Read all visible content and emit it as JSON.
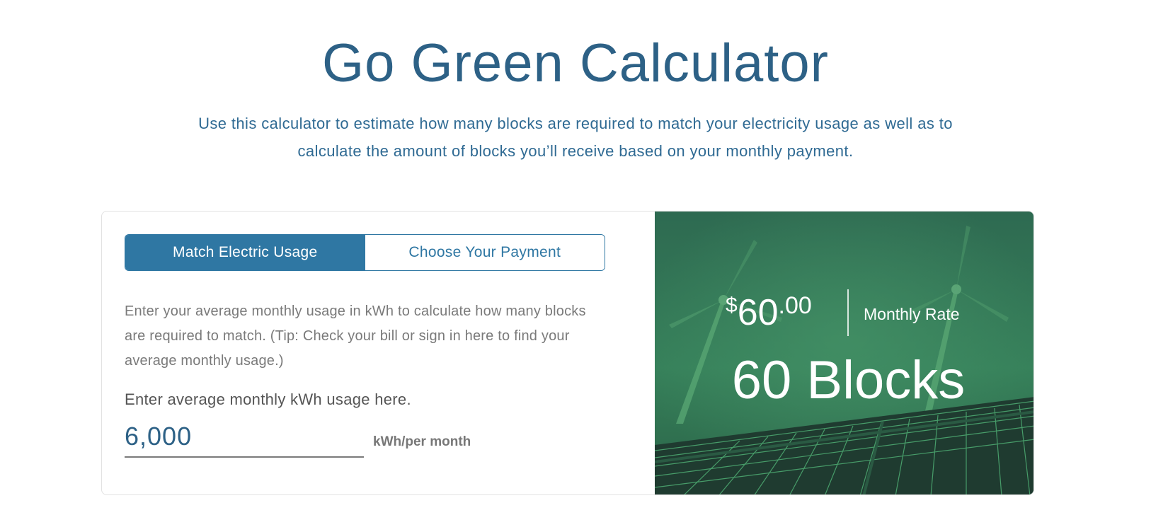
{
  "page": {
    "title": "Go Green Calculator",
    "subtitle": "Use this calculator to estimate how many blocks are required to match your electricity usage as well as to calculate the amount of blocks you’ll receive based on your monthly payment."
  },
  "tabs": [
    {
      "label": "Match Electric Usage",
      "active": true
    },
    {
      "label": "Choose Your Payment",
      "active": false
    }
  ],
  "form": {
    "description": "Enter your average monthly usage in kWh to calculate how many blocks are required to match. (Tip: Check your bill or sign in here to find your average monthly usage.)",
    "field_label": "Enter average monthly kWh usage here.",
    "usage_value": "6,000",
    "unit": "kWh/per month"
  },
  "result": {
    "currency_symbol": "$",
    "dollars": "60",
    "cents": ".00",
    "rate_label": "Monthly Rate",
    "blocks": "60 Blocks"
  },
  "colors": {
    "accent": "#2f77a3",
    "title": "#2d6186",
    "panel_green": "#2f6b4f"
  },
  "icons": {
    "background": "wind-turbines-solar-panels-illustration"
  }
}
